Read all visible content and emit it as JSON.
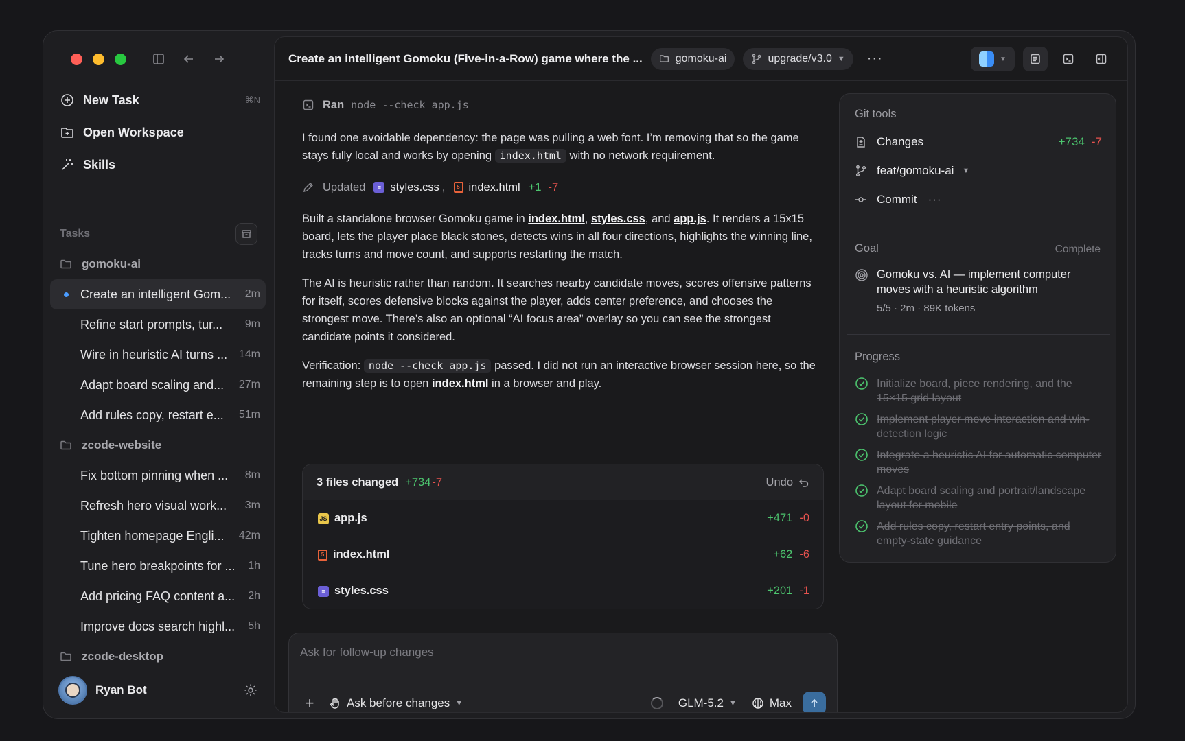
{
  "sidebar": {
    "nav": [
      {
        "label": "New Task",
        "shortcut": "⌘N",
        "icon": "new-task-icon"
      },
      {
        "label": "Open Workspace",
        "icon": "folder-plus-icon"
      },
      {
        "label": "Skills",
        "icon": "wand-icon"
      }
    ],
    "tasks_label": "Tasks",
    "groups": [
      {
        "name": "gomoku-ai",
        "tasks": [
          {
            "title": "Create an intelligent Gom...",
            "age": "2m",
            "active": true
          },
          {
            "title": "Refine start prompts, tur...",
            "age": "9m"
          },
          {
            "title": "Wire in heuristic AI turns ...",
            "age": "14m"
          },
          {
            "title": "Adapt board scaling and...",
            "age": "27m"
          },
          {
            "title": "Add rules copy, restart e...",
            "age": "51m"
          }
        ]
      },
      {
        "name": "zcode-website",
        "tasks": [
          {
            "title": "Fix bottom pinning when ...",
            "age": "8m"
          },
          {
            "title": "Refresh hero visual work...",
            "age": "3m"
          },
          {
            "title": "Tighten homepage Engli...",
            "age": "42m"
          },
          {
            "title": "Tune hero breakpoints for ...",
            "age": "1h"
          },
          {
            "title": "Add pricing FAQ content a...",
            "age": "2h"
          },
          {
            "title": "Improve docs search highl...",
            "age": "5h"
          }
        ]
      },
      {
        "name": "zcode-desktop",
        "tasks": []
      }
    ],
    "user": {
      "name": "Ryan Bot"
    }
  },
  "topbar": {
    "title": "Create an intelligent Gomoku (Five-in-a-Row) game where the ...",
    "workspace": "gomoku-ai",
    "branch": "upgrade/v3.0",
    "more": "···"
  },
  "conversation": {
    "ran_label": "Ran",
    "ran_cmd": "node --check app.js",
    "p1_a": "I found one avoidable dependency: the page was pulling a web font. I’m removing that so the game stays fully local and works by opening ",
    "p1_code": "index.html",
    "p1_b": " with no network requirement.",
    "updated_label": "Updated",
    "updated_file1": "styles.css",
    "updated_sep": ",",
    "updated_file2": "index.html",
    "updated_plus": "+1",
    "updated_minus": "-7",
    "p2_a": "Built a standalone browser Gomoku game in ",
    "p2_l1": "index.html",
    "p2_s1": ", ",
    "p2_l2": "styles.css",
    "p2_s2": ", and ",
    "p2_l3": "app.js",
    "p2_b": ". It renders a 15x15 board, lets the player place black stones, detects wins in all four directions, highlights the winning line, tracks turns and move count, and supports restarting the match.",
    "p3": "The AI is heuristic rather than random. It searches nearby candidate moves, scores offensive patterns for itself, scores defensive blocks against the player, adds center preference, and chooses the strongest move. There’s also an optional “AI focus area” overlay so you can see the strongest candidate points it considered.",
    "p4_a": "Verification: ",
    "p4_code": "node --check app.js",
    "p4_b": " passed. I did not run an interactive browser session here, so the remaining step is to open ",
    "p4_link": "index.html",
    "p4_c": " in a browser and play."
  },
  "files_card": {
    "count_label": "3 files changed",
    "plus": "+734",
    "minus": "-7",
    "undo_label": "Undo",
    "files": [
      {
        "name": "app.js",
        "plus": "+471",
        "minus": "-0",
        "type": "js"
      },
      {
        "name": "index.html",
        "plus": "+62",
        "minus": "-6",
        "type": "html"
      },
      {
        "name": "styles.css",
        "plus": "+201",
        "minus": "-1",
        "type": "css"
      }
    ]
  },
  "composer": {
    "placeholder": "Ask for follow-up changes",
    "mode": "Ask before changes",
    "model": "GLM-5.2",
    "effort": "Max"
  },
  "git_panel": {
    "title": "Git tools",
    "changes_label": "Changes",
    "changes_plus": "+734",
    "changes_minus": "-7",
    "branch": "feat/gomoku-ai",
    "commit_label": "Commit",
    "commit_more": "···",
    "goal_label": "Goal",
    "goal_status": "Complete",
    "goal_text": "Gomoku vs. AI — implement computer moves with a heuristic algorithm",
    "goal_meta": "5/5 · 2m · 89K tokens",
    "progress_label": "Progress",
    "progress": [
      "Initialize board, piece rendering, and the 15×15 grid layout",
      "Implement player move interaction and win-detection logic",
      "Integrate a heuristic AI for automatic computer moves",
      "Adapt board scaling and portrait/landscape layout for mobile",
      "Add rules copy, restart entry points, and empty-state guidance"
    ]
  },
  "colors": {
    "accent": "#4a9cff",
    "added": "#4cc46e",
    "removed": "#e6524e",
    "send": "#3a6d9e"
  }
}
